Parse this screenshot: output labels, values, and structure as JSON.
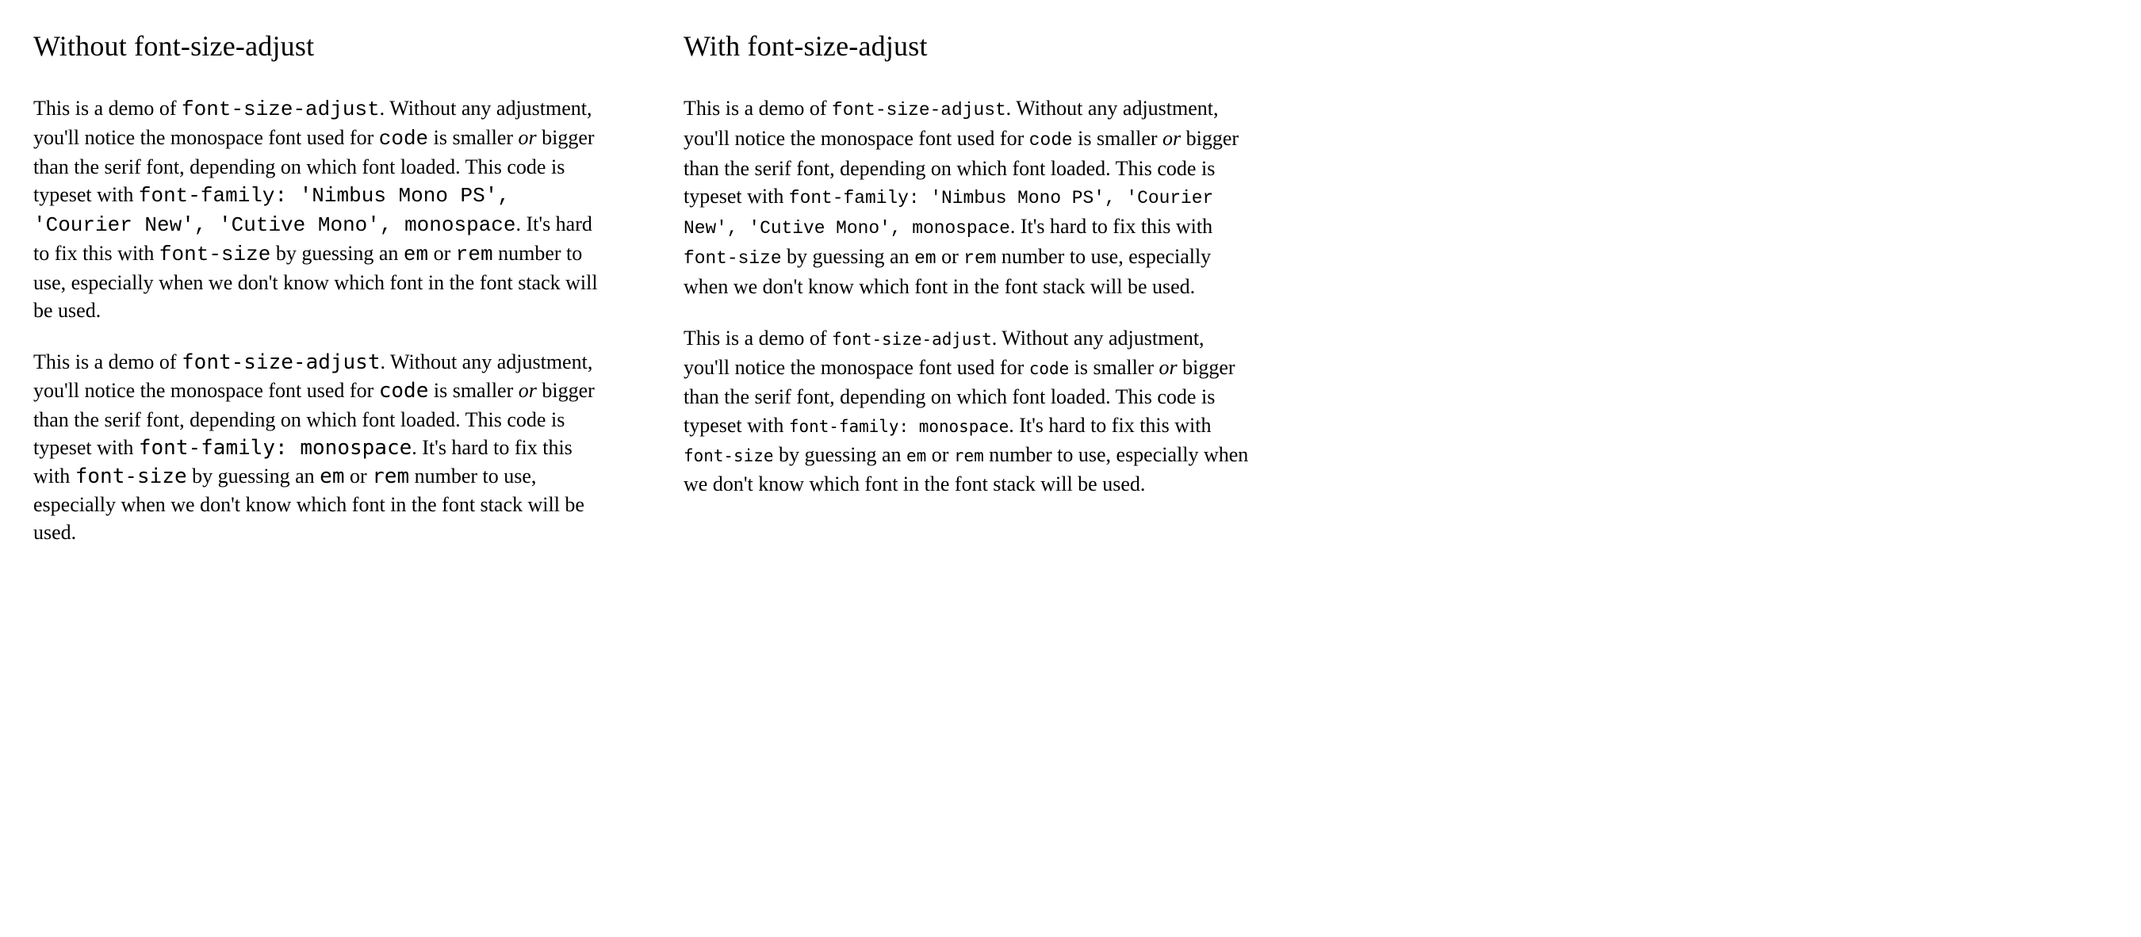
{
  "left": {
    "heading": "Without font-size-adjust"
  },
  "right": {
    "heading": "With font-size-adjust"
  },
  "para1": {
    "t1": "This is a demo of ",
    "c1": "font-size-adjust",
    "t2": ". Without any adjustment, you'll notice the monospace font used for ",
    "c2": "code",
    "t3": " is smaller ",
    "em1": "or",
    "t4": " bigger than the serif font, depending on which font loaded. This code is typeset with ",
    "c3": "font-family: 'Nimbus Mono PS', 'Courier New', 'Cutive Mono', monospace",
    "t5": ". It's hard to fix this with ",
    "c4": "font-size",
    "t6": " by guessing an ",
    "c5": "em",
    "t7": " or ",
    "c6": "rem",
    "t8": " number to use, especially when we don't know which font in the font stack will be used."
  },
  "para2": {
    "t1": "This is a demo of ",
    "c1": "font-size-adjust",
    "t2": ". Without any adjustment, you'll notice the monospace font used for ",
    "c2": "code",
    "t3": " is smaller ",
    "em1": "or",
    "t4": " bigger than the serif font, depending on which font loaded. This code is typeset with ",
    "c3": "font-family: monospace",
    "t5": ". It's hard to fix this with ",
    "c4": "font-size",
    "t6": " by guessing an ",
    "c5": "em",
    "t7": " or ",
    "c6": "rem",
    "t8": " number to use, especially when we don't know which font in the font stack will be used."
  }
}
